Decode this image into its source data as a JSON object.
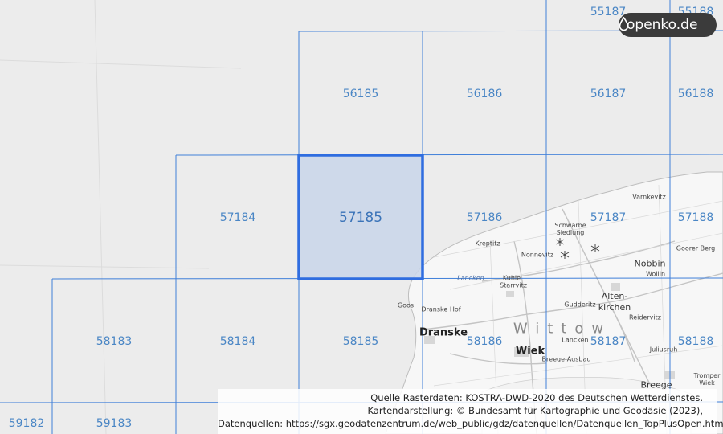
{
  "map": {
    "selected_cell": "57185",
    "cells": [
      {
        "row": 0,
        "col": 4,
        "label": "55187"
      },
      {
        "row": 0,
        "col": 5,
        "label": "55188"
      },
      {
        "row": 1,
        "col": 2,
        "label": "56185"
      },
      {
        "row": 1,
        "col": 3,
        "label": "56186"
      },
      {
        "row": 1,
        "col": 4,
        "label": "56187"
      },
      {
        "row": 1,
        "col": 5,
        "label": "56188"
      },
      {
        "row": 2,
        "col": 1,
        "label": "57184"
      },
      {
        "row": 2,
        "col": 2,
        "label": "57185"
      },
      {
        "row": 2,
        "col": 3,
        "label": "57186"
      },
      {
        "row": 2,
        "col": 4,
        "label": "57187"
      },
      {
        "row": 2,
        "col": 5,
        "label": "57188"
      },
      {
        "row": 3,
        "col": 0,
        "label": "58183"
      },
      {
        "row": 3,
        "col": 1,
        "label": "58184"
      },
      {
        "row": 3,
        "col": 2,
        "label": "58185"
      },
      {
        "row": 3,
        "col": 3,
        "label": "58186"
      },
      {
        "row": 3,
        "col": 4,
        "label": "58187"
      },
      {
        "row": 3,
        "col": 5,
        "label": "58188"
      },
      {
        "row": 4,
        "col": -1,
        "label": "59182"
      },
      {
        "row": 4,
        "col": 0,
        "label": "59183"
      }
    ],
    "places": {
      "dranske": "Dranske",
      "wiek": "Wiek",
      "altenkirchen": "Alten-\nkirchen",
      "wittow": "Wittow",
      "nobbin": "Nobbin",
      "breege": "Breege",
      "kreptitz": "Kreptitz",
      "nonnevitz": "Nonnevitz",
      "schwarbe": "Schwarbe\nSiedlung",
      "lancken": "Lancken",
      "kuhle": "Kuhle",
      "starrvitz": "Starrvitz",
      "goos": "Goos",
      "dranske_hof": "Dranske Hof",
      "gudderitz": "Gudderitz",
      "reidervitz": "Reidervitz",
      "lanckensburg": "Lancken",
      "breege_ausbau": "Breege-Ausbau",
      "juliusruh": "Juliusruh",
      "varnkevitz": "Varnkevitz",
      "wollin": "Wollin",
      "goorer_berg": "Goorer Berg",
      "tromper_wiek": "Tromper\nWiek"
    }
  },
  "branding": {
    "logo_text": "openko.de"
  },
  "attribution": {
    "line1": "Quelle Rasterdaten: KOSTRA-DWD-2020 des Deutschen Wetterdienstes.",
    "line2": "Kartendarstellung: © Bundesamt für Kartographie und Geodäsie (2023),",
    "line3": "Datenquellen: https://sgx.geodatenzentrum.de/web_public/gdz/datenquellen/Datenquellen_TopPlusOpen.html"
  },
  "colors": {
    "grid_line": "#3f7fd9",
    "grid_label": "#4a86c5",
    "selected_fill": "#c9d6ea",
    "selected_border": "#2f6de0",
    "sea": "#ececec",
    "land": "#f7f7f7",
    "logo_bg": "#3b3b3b"
  }
}
